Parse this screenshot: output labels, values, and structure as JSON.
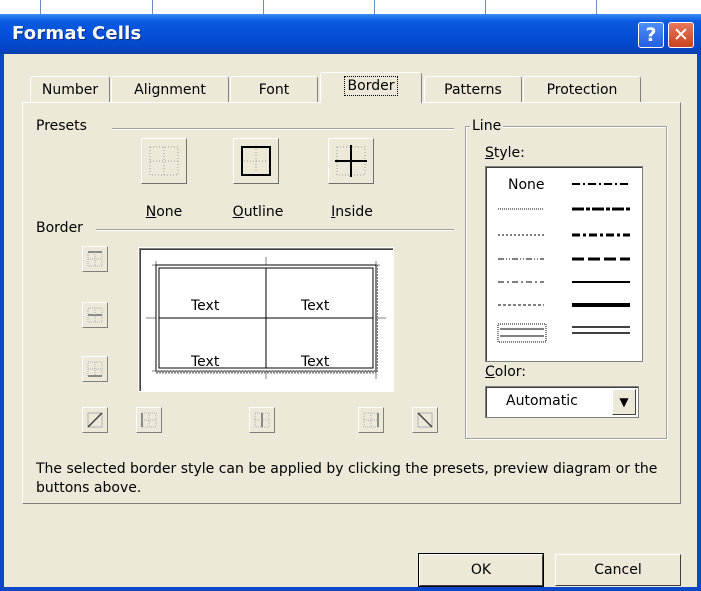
{
  "window": {
    "title": "Format Cells",
    "help_glyph": "?",
    "close_glyph": "✕"
  },
  "tabs": [
    {
      "label": "Number"
    },
    {
      "label": "Alignment"
    },
    {
      "label": "Font"
    },
    {
      "label": "Border",
      "active": true
    },
    {
      "label": "Patterns"
    },
    {
      "label": "Protection"
    }
  ],
  "presets": {
    "group_label": "Presets",
    "none": {
      "mnemonic": "N",
      "rest": "one"
    },
    "outline": {
      "mnemonic": "O",
      "rest": "utline"
    },
    "inside": {
      "mnemonic": "I",
      "rest": "nside"
    }
  },
  "border": {
    "group_label": "Border",
    "preview_cells": [
      "Text",
      "Text",
      "Text",
      "Text"
    ]
  },
  "line": {
    "group_label": "Line",
    "style_label": {
      "mnemonic": "S",
      "rest": "tyle:"
    },
    "style_none": "None",
    "color_label": {
      "mnemonic": "C",
      "rest": "olor:"
    },
    "color_value": "Automatic",
    "combo_arrow_glyph": "▼"
  },
  "help_text": "The selected border style can be applied by clicking the presets, preview diagram or the buttons above.",
  "buttons": {
    "ok": "OK",
    "cancel": "Cancel"
  },
  "colors": {
    "titlebar": "#0350d6",
    "dialog_bg": "#ECE9D8",
    "close": "#c84220"
  }
}
